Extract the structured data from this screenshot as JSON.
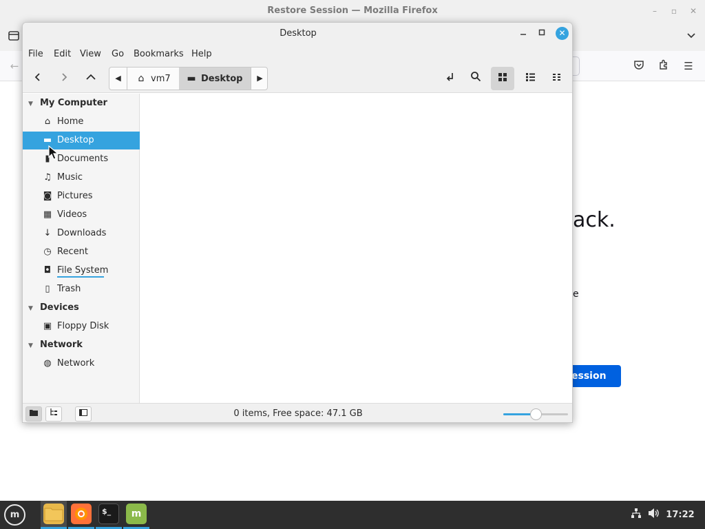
{
  "firefox": {
    "title": "Restore Session — Mozilla Firefox",
    "heading_fragment": "ack.",
    "text_fragment": "e",
    "restore_button_fragment": "ession"
  },
  "nemo": {
    "title": "Desktop",
    "menu": [
      "File",
      "Edit",
      "View",
      "Go",
      "Bookmarks",
      "Help"
    ],
    "path": [
      {
        "label": "vm7",
        "icon": "home-icon"
      },
      {
        "label": "Desktop",
        "icon": "desktop-icon",
        "active": true
      }
    ],
    "sidebar": {
      "sections": [
        {
          "title": "My Computer",
          "items": [
            {
              "label": "Home",
              "icon": "home-icon"
            },
            {
              "label": "Desktop",
              "icon": "desktop-icon",
              "selected": true
            },
            {
              "label": "Documents",
              "icon": "documents-icon"
            },
            {
              "label": "Music",
              "icon": "music-icon"
            },
            {
              "label": "Pictures",
              "icon": "camera-icon"
            },
            {
              "label": "Videos",
              "icon": "film-icon"
            },
            {
              "label": "Downloads",
              "icon": "download-icon"
            },
            {
              "label": "Recent",
              "icon": "clock-icon"
            },
            {
              "label": "File System",
              "icon": "drive-icon"
            },
            {
              "label": "Trash",
              "icon": "trash-icon"
            }
          ]
        },
        {
          "title": "Devices",
          "items": [
            {
              "label": "Floppy Disk",
              "icon": "floppy-icon"
            }
          ]
        },
        {
          "title": "Network",
          "items": [
            {
              "label": "Network",
              "icon": "globe-icon"
            }
          ]
        }
      ]
    },
    "status": "0 items, Free space: 47.1 GB",
    "zoom_level_fraction": 0.5
  },
  "taskbar": {
    "clock": "17:22",
    "apps": [
      "files",
      "firefox",
      "terminal",
      "mintupdate"
    ]
  },
  "colors": {
    "accent": "#35a3df",
    "firefox_button": "#0061e0",
    "taskbar": "#2e2e2e"
  }
}
